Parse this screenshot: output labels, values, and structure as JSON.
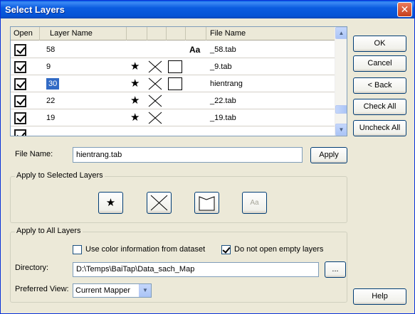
{
  "window": {
    "title": "Select Layers",
    "close_symbol": "✕"
  },
  "grid": {
    "columns": [
      "Open",
      "Layer Name",
      "",
      "",
      "",
      "",
      "File Name"
    ],
    "rows": [
      {
        "open": true,
        "layer": "58",
        "star": false,
        "x": false,
        "box": false,
        "aa": true,
        "file": "_58.tab",
        "selected": false
      },
      {
        "open": true,
        "layer": "9",
        "star": true,
        "x": true,
        "box": true,
        "aa": false,
        "file": "_9.tab",
        "selected": false
      },
      {
        "open": true,
        "layer": "30",
        "star": true,
        "x": true,
        "box": true,
        "aa": false,
        "file": "hientrang",
        "selected": true
      },
      {
        "open": true,
        "layer": "22",
        "star": true,
        "x": true,
        "box": false,
        "aa": false,
        "file": "_22.tab",
        "selected": false
      },
      {
        "open": true,
        "layer": "19",
        "star": true,
        "x": true,
        "box": false,
        "aa": false,
        "file": "_19.tab",
        "selected": false
      }
    ],
    "icons": {
      "star": "★",
      "aa": "Aa",
      "scroll_up": "▲",
      "scroll_down": "▼"
    }
  },
  "buttons": {
    "ok": "OK",
    "cancel": "Cancel",
    "back": "< Back",
    "check_all": "Check All",
    "uncheck_all": "Uncheck All",
    "help": "Help",
    "apply": "Apply",
    "browse": "..."
  },
  "file_name": {
    "label": "File Name:",
    "value": "hientrang.tab"
  },
  "apply_selected": {
    "title": "Apply to Selected Layers",
    "star": "★",
    "aa": "Aa"
  },
  "apply_all": {
    "title": "Apply to All Layers",
    "use_color_label": "Use color information from dataset",
    "use_color_checked": false,
    "no_empty_label": "Do not open empty layers",
    "no_empty_checked": true,
    "directory_label": "Directory:",
    "directory_value": "D:\\Temps\\BaiTap\\Data_sach_Map",
    "view_label": "Preferred View:",
    "view_value": "Current Mapper",
    "combo_arrow": "▼"
  }
}
